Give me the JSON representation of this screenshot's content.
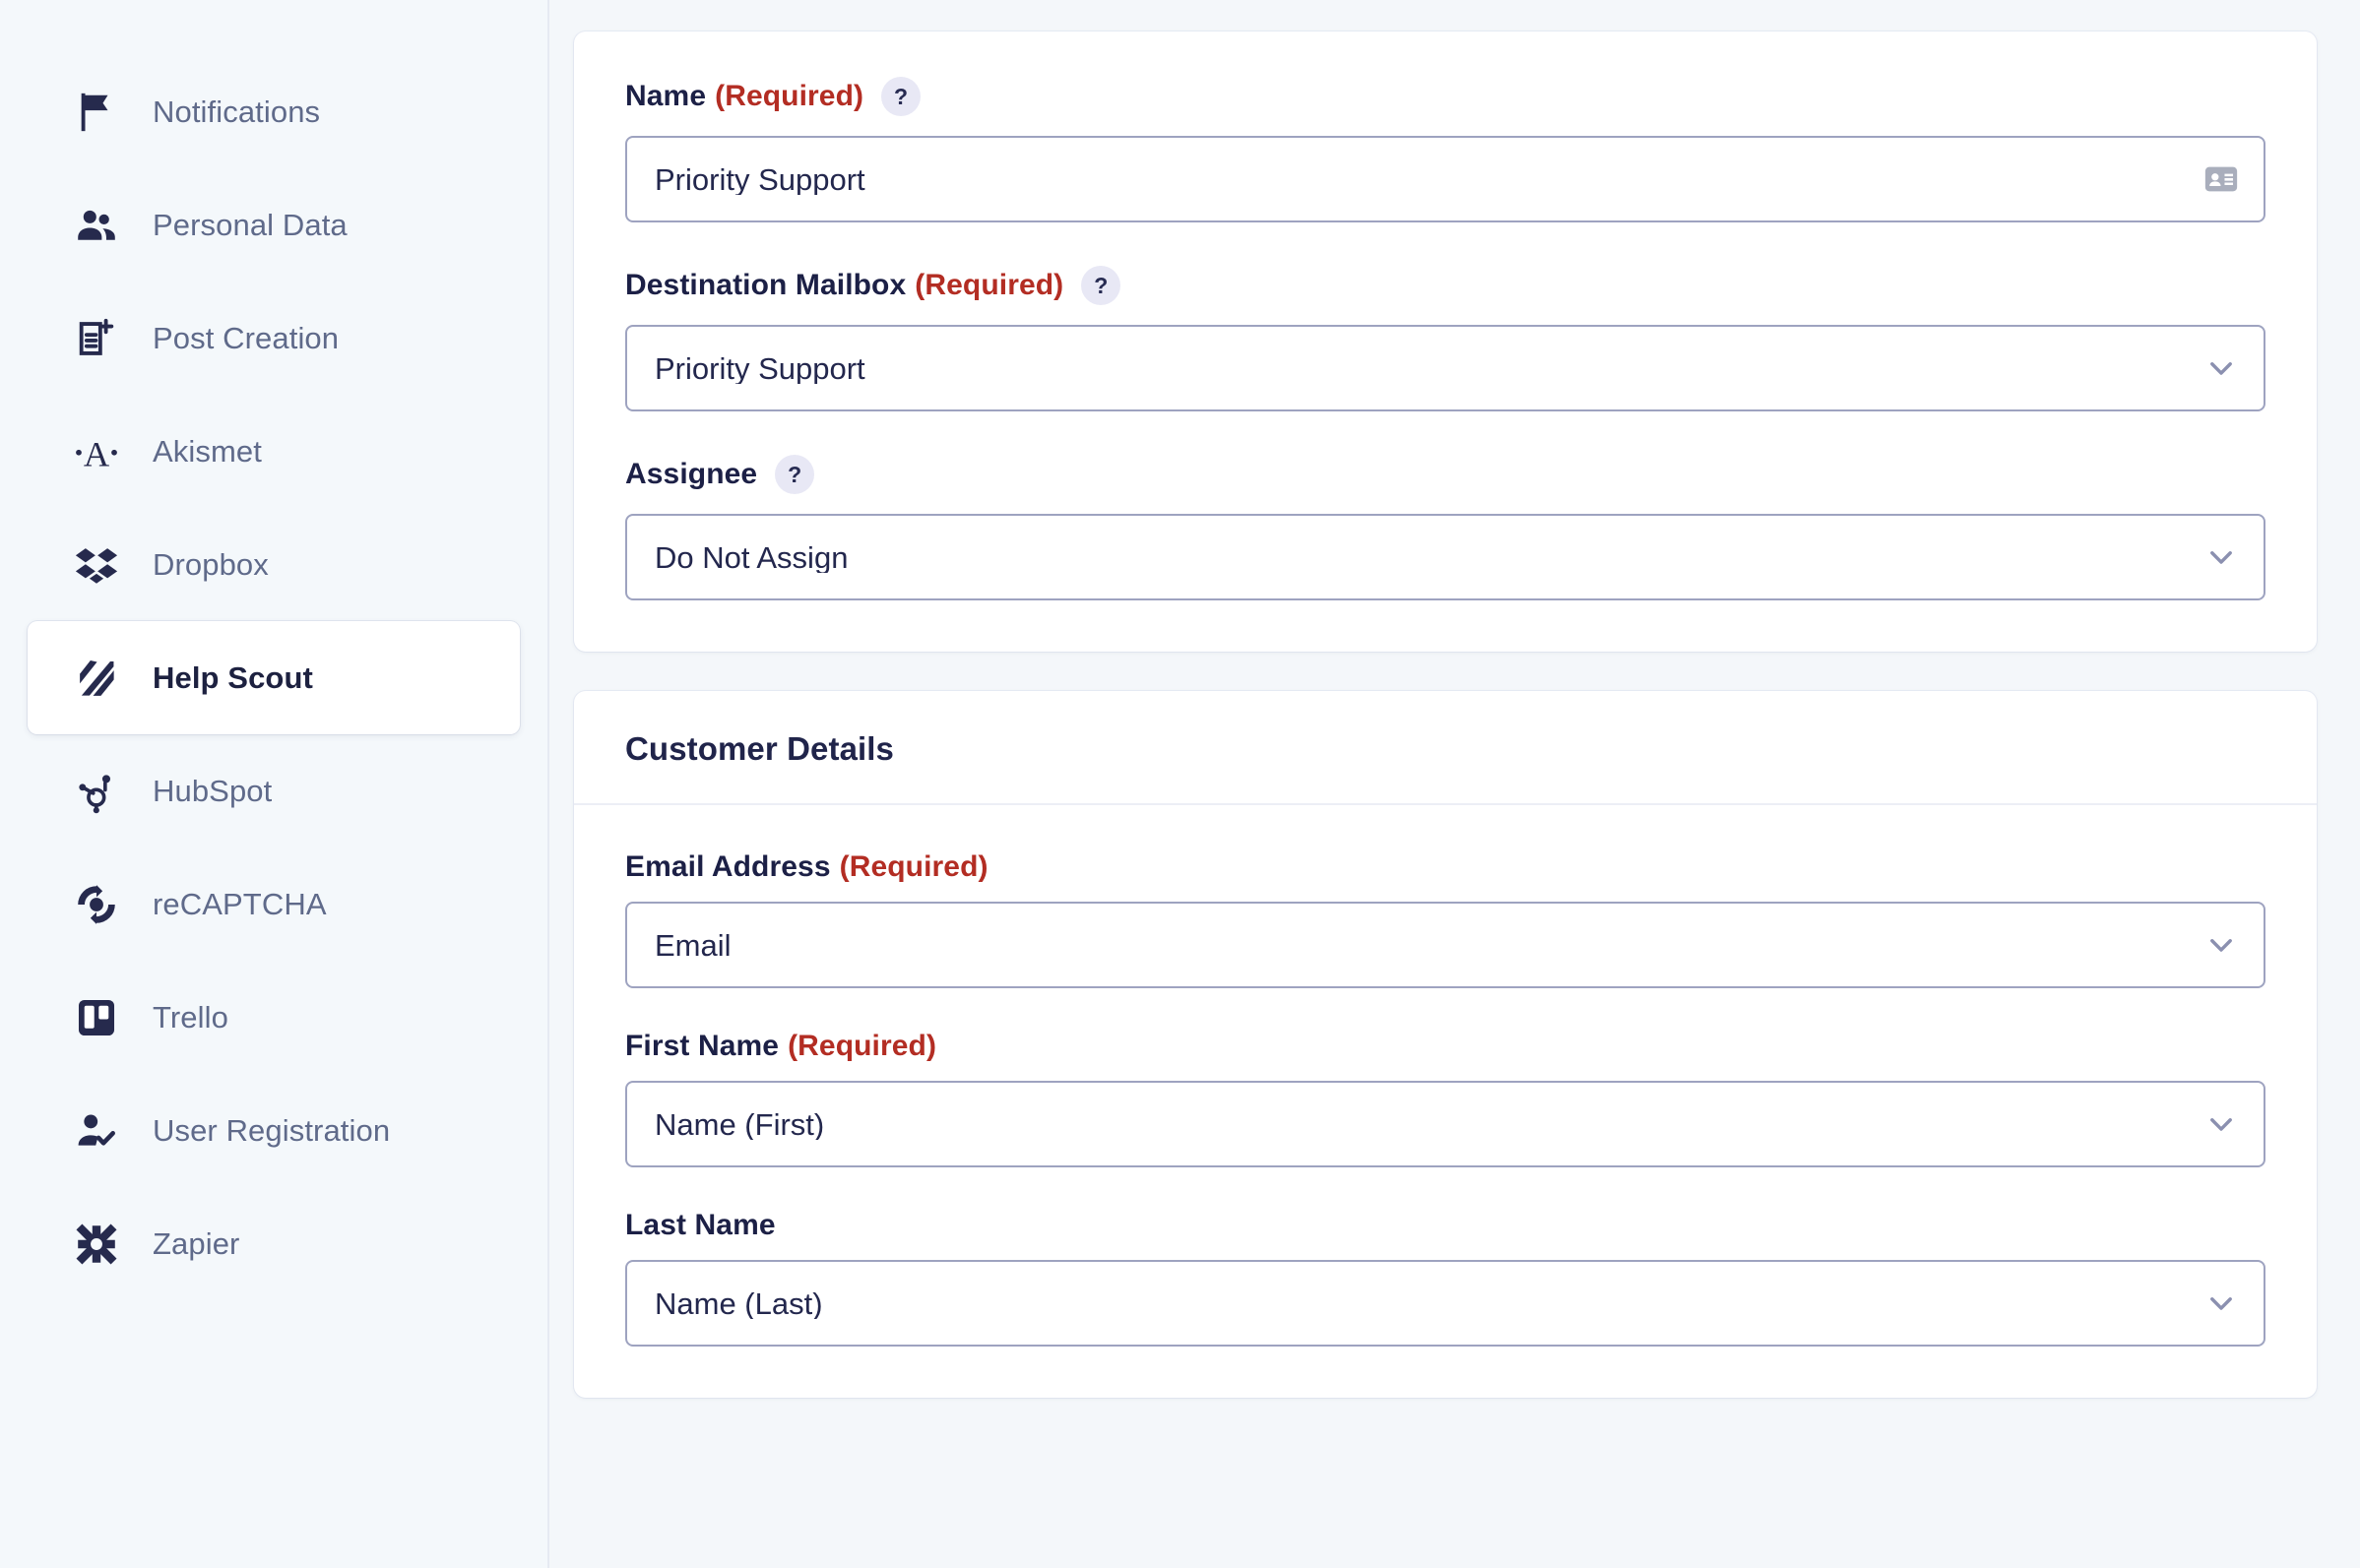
{
  "sidebar": {
    "items": [
      {
        "label": "Notifications",
        "icon": "flag-icon",
        "active": false
      },
      {
        "label": "Personal Data",
        "icon": "users-icon",
        "active": false
      },
      {
        "label": "Post Creation",
        "icon": "document-plus-icon",
        "active": false
      },
      {
        "label": "Akismet",
        "icon": "akismet-icon",
        "active": false
      },
      {
        "label": "Dropbox",
        "icon": "dropbox-icon",
        "active": false
      },
      {
        "label": "Help Scout",
        "icon": "help-scout-icon",
        "active": true
      },
      {
        "label": "HubSpot",
        "icon": "hubspot-icon",
        "active": false
      },
      {
        "label": "reCAPTCHA",
        "icon": "recaptcha-icon",
        "active": false
      },
      {
        "label": "Trello",
        "icon": "trello-icon",
        "active": false
      },
      {
        "label": "User Registration",
        "icon": "user-check-icon",
        "active": false
      },
      {
        "label": "Zapier",
        "icon": "zapier-icon",
        "active": false
      }
    ]
  },
  "connection_card": {
    "name_field": {
      "label": "Name",
      "required_text": "(Required)",
      "help": "?",
      "value": "Priority Support",
      "icon": "contact-card-icon"
    },
    "mailbox_field": {
      "label": "Destination Mailbox",
      "required_text": "(Required)",
      "help": "?",
      "value": "Priority Support",
      "icon": "chevron-down-icon"
    },
    "assignee_field": {
      "label": "Assignee",
      "required_text": "",
      "help": "?",
      "value": "Do Not Assign",
      "icon": "chevron-down-icon"
    }
  },
  "customer_card": {
    "title": "Customer Details",
    "email_field": {
      "label": "Email Address",
      "required_text": "(Required)",
      "value": "Email",
      "icon": "chevron-down-icon"
    },
    "first_name_field": {
      "label": "First Name",
      "required_text": "(Required)",
      "value": "Name (First)",
      "icon": "chevron-down-icon"
    },
    "last_name_field": {
      "label": "Last Name",
      "required_text": "",
      "value": "Name (Last)",
      "icon": "chevron-down-icon"
    }
  },
  "colors": {
    "page_background": "#f4f7fa",
    "sidebar_background": "#f4f8fb",
    "card_background": "#ffffff",
    "required_red": "#b32d23",
    "icon_navy": "#262a4d",
    "label_navy": "#1c2046",
    "nav_text": "#5f6a8a",
    "input_border": "#9ea3c0",
    "help_badge_background": "#e8e8f5"
  }
}
